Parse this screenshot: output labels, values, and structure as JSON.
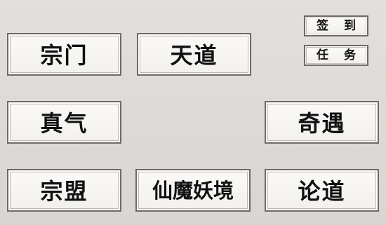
{
  "menu": {
    "zongmen": "宗门",
    "tiandao": "天道",
    "zhenqi": "真气",
    "qiyu": "奇遇",
    "zongmeng": "宗盟",
    "xianmo": "仙魔妖境",
    "lundao": "论道"
  },
  "side": {
    "qiandao": "签到",
    "renwu": "任务"
  }
}
